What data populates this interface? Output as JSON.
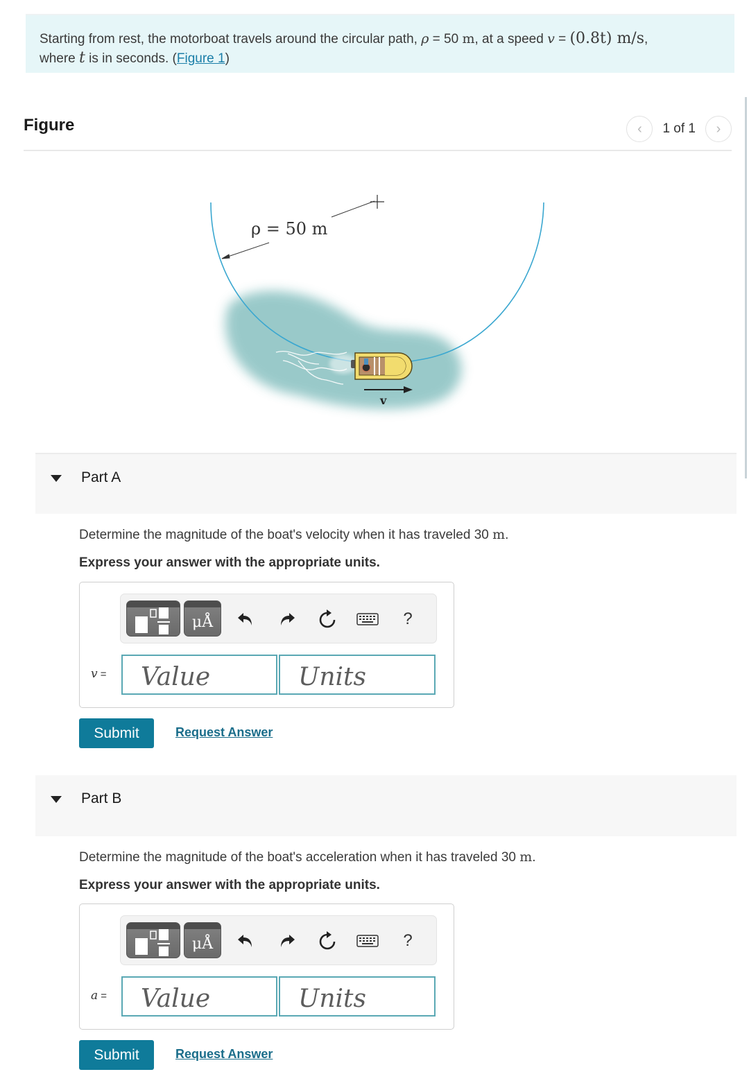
{
  "intro": {
    "text_1": "Starting from rest, the motorboat travels around the circular path, ",
    "rho_symbol": "ρ",
    "rho_eq": " = 50 ",
    "rho_unit": "m",
    "text_2": ", at a speed ",
    "v_symbol": "v",
    "v_eq": " = ",
    "v_expr": "(0.8t) m/s",
    "text_3": ",",
    "text_4": "where ",
    "t_symbol": "t",
    "text_5": " is in seconds. (",
    "figure_link": "Figure 1",
    "text_6": ")"
  },
  "figure": {
    "title": "Figure",
    "pager": {
      "prev_icon": "chevron-left-icon",
      "text": "1 of 1",
      "next_icon": "chevron-right-icon"
    },
    "diagram": {
      "radius_label": "ρ = 50 m",
      "velocity_label": "v",
      "colors": {
        "path": "#3aa7d0",
        "water": "#8fc4c4",
        "boat": "#f2dc6e"
      }
    }
  },
  "parts": [
    {
      "title": "Part A",
      "question_text": "Determine the magnitude of the boat's velocity when it has traveled 30 ",
      "question_unit": "m",
      "question_end": ".",
      "instruction": "Express your answer with the appropriate units.",
      "variable": "v",
      "equals": " =",
      "toolbar": {
        "templates_icon": "templates-icon",
        "units_label": "μÅ",
        "undo_icon": "undo-icon",
        "redo_icon": "redo-icon",
        "reset_icon": "reset-icon",
        "keyboard_icon": "keyboard-icon",
        "help_label": "?"
      },
      "value_placeholder": "Value",
      "units_placeholder": "Units",
      "submit_label": "Submit",
      "request_label": "Request Answer"
    },
    {
      "title": "Part B",
      "question_text": "Determine the magnitude of the boat's acceleration when it has traveled 30 ",
      "question_unit": "m",
      "question_end": ".",
      "instruction": "Express your answer with the appropriate units.",
      "variable": "a",
      "equals": " =",
      "toolbar": {
        "templates_icon": "templates-icon",
        "units_label": "μÅ",
        "undo_icon": "undo-icon",
        "redo_icon": "redo-icon",
        "reset_icon": "reset-icon",
        "keyboard_icon": "keyboard-icon",
        "help_label": "?"
      },
      "value_placeholder": "Value",
      "units_placeholder": "Units",
      "submit_label": "Submit",
      "request_label": "Request Answer"
    }
  ],
  "colors": {
    "accent": "#0f7b9a",
    "link": "#1a7ea8",
    "intro_bg": "#e6f6f8",
    "field_border": "#5aa8b4"
  }
}
